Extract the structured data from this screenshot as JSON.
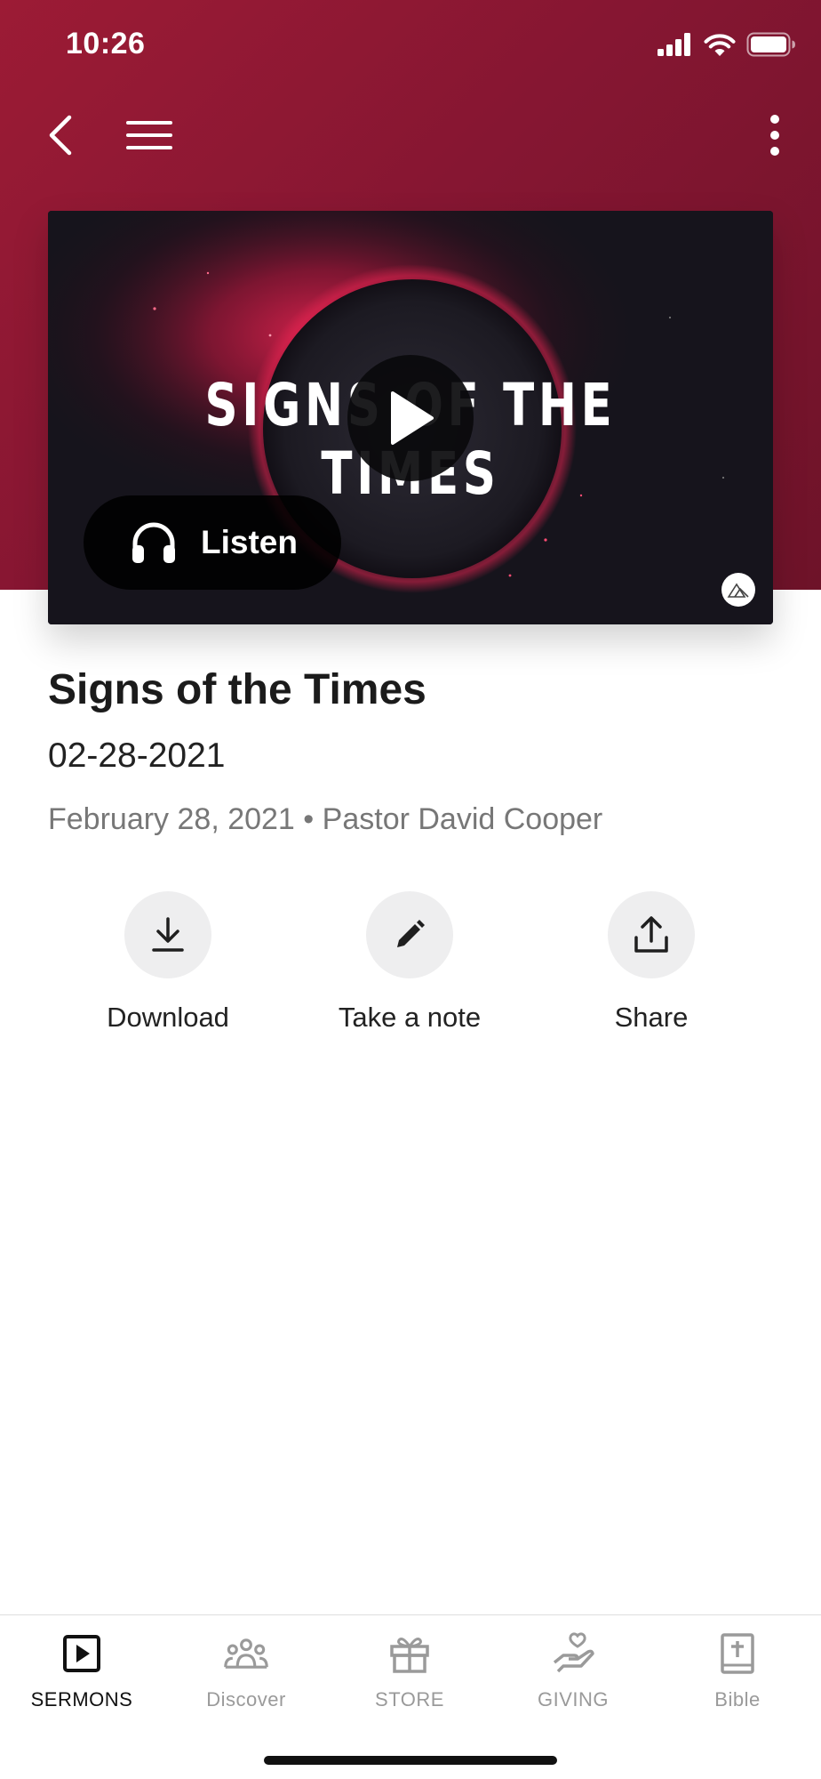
{
  "status_bar": {
    "time": "10:26"
  },
  "video": {
    "series_title": "SIGNS OF THE TIMES",
    "listen_label": "Listen"
  },
  "sermon": {
    "title": "Signs of the Times",
    "subtitle": "02-28-2021",
    "date": "February 28, 2021",
    "separator": "•",
    "speaker": "Pastor David Cooper"
  },
  "actions": [
    {
      "label": "Download",
      "icon": "download-icon"
    },
    {
      "label": "Take a note",
      "icon": "pencil-icon"
    },
    {
      "label": "Share",
      "icon": "share-icon"
    }
  ],
  "tabs": [
    {
      "label": "SERMONS",
      "icon": "play-square-icon",
      "active": true
    },
    {
      "label": "Discover",
      "icon": "people-icon",
      "active": false
    },
    {
      "label": "STORE",
      "icon": "gift-icon",
      "active": false
    },
    {
      "label": "GIVING",
      "icon": "giving-hand-icon",
      "active": false
    },
    {
      "label": "Bible",
      "icon": "bible-icon",
      "active": false
    }
  ],
  "colors": {
    "hero_bg": "#861632",
    "accent_red": "#e0234f",
    "tab_active": "#111111",
    "tab_inactive": "#9a9a9a"
  }
}
